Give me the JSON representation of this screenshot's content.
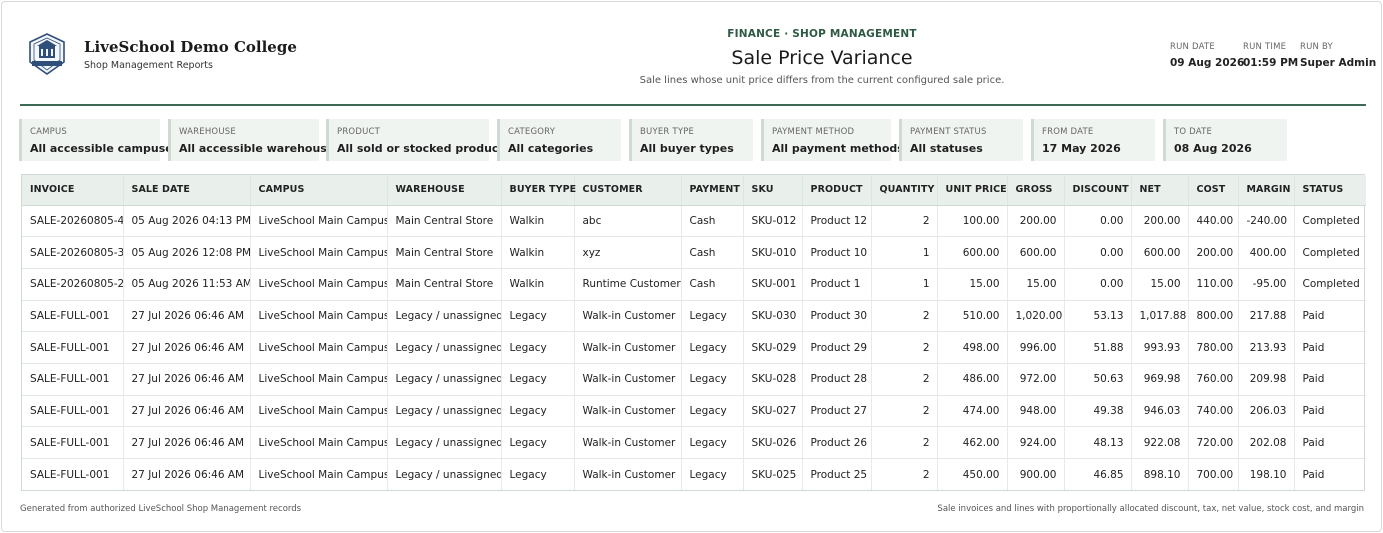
{
  "header": {
    "college_name": "LiveSchool Demo College",
    "college_sub": "Shop Management Reports",
    "kicker": "FINANCE · SHOP MANAGEMENT",
    "title": "Sale Price Variance",
    "subtitle": "Sale lines whose unit price differs from the current configured sale price.",
    "meta": [
      {
        "label": "RUN DATE",
        "value": "09 Aug 2026"
      },
      {
        "label": "RUN TIME",
        "value": "01:59 PM"
      },
      {
        "label": "RUN BY",
        "value": "Super Admin"
      }
    ]
  },
  "filters": [
    {
      "label": "CAMPUS",
      "value": "All accessible campuses"
    },
    {
      "label": "WAREHOUSE",
      "value": "All accessible warehouses"
    },
    {
      "label": "PRODUCT",
      "value": "All sold or stocked products"
    },
    {
      "label": "CATEGORY",
      "value": "All categories"
    },
    {
      "label": "BUYER TYPE",
      "value": "All buyer types"
    },
    {
      "label": "PAYMENT METHOD",
      "value": "All payment methods"
    },
    {
      "label": "PAYMENT STATUS",
      "value": "All statuses"
    },
    {
      "label": "FROM DATE",
      "value": "17 May 2026"
    },
    {
      "label": "TO DATE",
      "value": "08 Aug 2026"
    }
  ],
  "table": {
    "columns": [
      "INVOICE",
      "SALE DATE",
      "CAMPUS",
      "WAREHOUSE",
      "BUYER TYPE",
      "CUSTOMER",
      "PAYMENT",
      "SKU",
      "PRODUCT",
      "QUANTITY",
      "UNIT PRICE",
      "GROSS",
      "DISCOUNT",
      "NET",
      "COST",
      "MARGIN",
      "STATUS"
    ],
    "rows": [
      [
        "SALE-20260805-4",
        "05 Aug 2026 04:13 PM",
        "LiveSchool Main Campus",
        "Main Central Store",
        "Walkin",
        "abc",
        "Cash",
        "SKU-012",
        "Product 12",
        "2",
        "100.00",
        "200.00",
        "0.00",
        "200.00",
        "440.00",
        "-240.00",
        "Completed"
      ],
      [
        "SALE-20260805-3",
        "05 Aug 2026 12:08 PM",
        "LiveSchool Main Campus",
        "Main Central Store",
        "Walkin",
        "xyz",
        "Cash",
        "SKU-010",
        "Product 10",
        "1",
        "600.00",
        "600.00",
        "0.00",
        "600.00",
        "200.00",
        "400.00",
        "Completed"
      ],
      [
        "SALE-20260805-2",
        "05 Aug 2026 11:53 AM",
        "LiveSchool Main Campus",
        "Main Central Store",
        "Walkin",
        "Runtime Customer",
        "Cash",
        "SKU-001",
        "Product 1",
        "1",
        "15.00",
        "15.00",
        "0.00",
        "15.00",
        "110.00",
        "-95.00",
        "Completed"
      ],
      [
        "SALE-FULL-001",
        "27 Jul 2026 06:46 AM",
        "LiveSchool Main Campus",
        "Legacy / unassigned",
        "Legacy",
        "Walk-in Customer",
        "Legacy",
        "SKU-030",
        "Product 30",
        "2",
        "510.00",
        "1,020.00",
        "53.13",
        "1,017.88",
        "800.00",
        "217.88",
        "Paid"
      ],
      [
        "SALE-FULL-001",
        "27 Jul 2026 06:46 AM",
        "LiveSchool Main Campus",
        "Legacy / unassigned",
        "Legacy",
        "Walk-in Customer",
        "Legacy",
        "SKU-029",
        "Product 29",
        "2",
        "498.00",
        "996.00",
        "51.88",
        "993.93",
        "780.00",
        "213.93",
        "Paid"
      ],
      [
        "SALE-FULL-001",
        "27 Jul 2026 06:46 AM",
        "LiveSchool Main Campus",
        "Legacy / unassigned",
        "Legacy",
        "Walk-in Customer",
        "Legacy",
        "SKU-028",
        "Product 28",
        "2",
        "486.00",
        "972.00",
        "50.63",
        "969.98",
        "760.00",
        "209.98",
        "Paid"
      ],
      [
        "SALE-FULL-001",
        "27 Jul 2026 06:46 AM",
        "LiveSchool Main Campus",
        "Legacy / unassigned",
        "Legacy",
        "Walk-in Customer",
        "Legacy",
        "SKU-027",
        "Product 27",
        "2",
        "474.00",
        "948.00",
        "49.38",
        "946.03",
        "740.00",
        "206.03",
        "Paid"
      ],
      [
        "SALE-FULL-001",
        "27 Jul 2026 06:46 AM",
        "LiveSchool Main Campus",
        "Legacy / unassigned",
        "Legacy",
        "Walk-in Customer",
        "Legacy",
        "SKU-026",
        "Product 26",
        "2",
        "462.00",
        "924.00",
        "48.13",
        "922.08",
        "720.00",
        "202.08",
        "Paid"
      ],
      [
        "SALE-FULL-001",
        "27 Jul 2026 06:46 AM",
        "LiveSchool Main Campus",
        "Legacy / unassigned",
        "Legacy",
        "Walk-in Customer",
        "Legacy",
        "SKU-025",
        "Product 25",
        "2",
        "450.00",
        "900.00",
        "46.85",
        "898.10",
        "700.00",
        "198.10",
        "Paid"
      ]
    ]
  },
  "footer": {
    "left": "Generated from authorized LiveSchool Shop Management records",
    "right": "Sale invoices and lines with proportionally allocated discount, tax, net value, stock cost, and margin"
  }
}
